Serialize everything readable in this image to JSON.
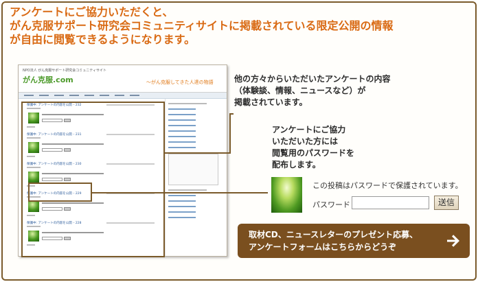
{
  "headline": {
    "line1": "アンケートにご協力いただくと、",
    "line2": "がん克服サポート研究会コミュニティサイトに掲載されている限定公開の情報",
    "line3": "が自由に閲覧できるようになります。"
  },
  "mini_site": {
    "org_name": "NPO法人 がん克服サポート研究会コミュニティサイト",
    "logo": "がん克服.com",
    "tagline": "～がん克服してきた人達の物語",
    "posts": [
      {
        "title": "保護中: アンケートの内容を公開 – 232"
      },
      {
        "title": "保護中: アンケートの内容を公開 – 231"
      },
      {
        "title": "保護中: アンケートの内容を公開 – 230"
      },
      {
        "title": "保護中: アンケートの内容を公開 – 229"
      },
      {
        "title": "保護中: アンケートの内容を公開 – 228"
      }
    ]
  },
  "callout1": {
    "line1": "他の方々からいただいたアンケートの内容",
    "line2": "（体験談、情報、ニュースなど）が",
    "line3": "掲載されています。"
  },
  "callout2": {
    "line1": "アンケートにご協力",
    "line2": "いただいた方には",
    "line3": "閲覧用のパスワードを",
    "line4": "配布します。"
  },
  "password_form": {
    "message": "この投稿はパスワードで保護されています。",
    "label": "パスワード",
    "value": "",
    "button": "送信"
  },
  "cta": {
    "line1": "取材CD、ニュースレターのプレゼント応募、",
    "line2": "アンケートフォームはこちらからどうぞ",
    "icon": "arrow-right-icon"
  },
  "colors": {
    "headline": "#d96a14",
    "frame": "#7a5a2a",
    "cta_bg": "#7a4f1f",
    "logo": "#4c9a2a"
  }
}
